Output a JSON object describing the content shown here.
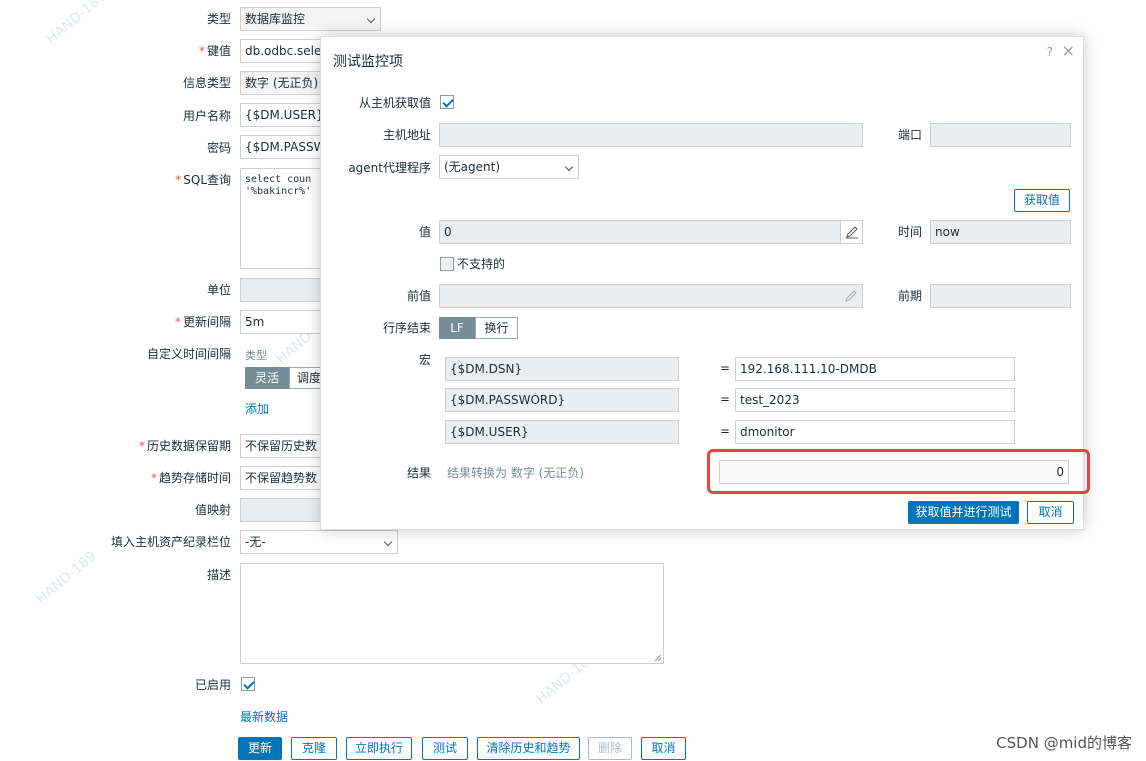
{
  "form": {
    "type_label": "类型",
    "type_value": "数据库监控",
    "key_label": "键值",
    "key_value": "db.odbc.select[",
    "info_type_label": "信息类型",
    "info_type_value": "数字 (无正负)",
    "user_label": "用户名称",
    "user_value": "{$DM.USER}",
    "password_label": "密码",
    "password_value": "{$DM.PASSWO",
    "sql_label": "SQL查询",
    "sql_line1": "select coun",
    "sql_line2": "'%bakincr%'",
    "unit_label": "单位",
    "interval_label": "更新间隔",
    "interval_value": "5m",
    "custom_interval_label": "自定义时间间隔",
    "custom_type_header": "类型",
    "flex_label": "灵活",
    "schedule_label": "调度",
    "add_link": "添加",
    "history_label": "历史数据保留期",
    "history_value": "不保留历史数",
    "trends_label": "趋势存储时间",
    "trends_value": "不保留趋势数",
    "valuemap_label": "值映射",
    "inventory_label": "填入主机资产纪录栏位",
    "inventory_value": "-无-",
    "desc_label": "描述",
    "enabled_label": "已启用",
    "latest_data_link": "最新数据"
  },
  "buttons": {
    "update": "更新",
    "clone": "克隆",
    "execute_now": "立即执行",
    "test": "测试",
    "clear_history": "清除历史和趋势",
    "delete": "删除",
    "cancel": "取消"
  },
  "dialog": {
    "title": "测试监控项",
    "help": "?",
    "close": "×",
    "get_from_host_label": "从主机获取值",
    "host_address_label": "主机地址",
    "port_label": "端口",
    "proxy_label": "agent代理程序",
    "proxy_value": "(无agent)",
    "get_value_button": "获取值",
    "value_label": "值",
    "value_value": "0",
    "time_label": "时间",
    "time_value": "now",
    "unsupported_label": "不支持的",
    "prev_value_label": "前值",
    "prev_time_label": "前期",
    "eol_label": "行序结束",
    "eol_lf": "LF",
    "eol_crlf": "换行",
    "macros_label": "宏",
    "macros": [
      {
        "name": "{$DM.DSN}",
        "value": "192.168.111.10-DMDB"
      },
      {
        "name": "{$DM.PASSWORD}",
        "value": "test_2023"
      },
      {
        "name": "{$DM.USER}",
        "value": "dmonitor"
      }
    ],
    "result_label": "结果",
    "result_note": "结果转换为 数字 (无正负)",
    "result_value": "0",
    "test_button": "获取值并进行测试",
    "cancel_button": "取消"
  },
  "watermark": "HAND-189",
  "footer": "CSDN @mid的博客",
  "colors": {
    "accent": "#0275b8",
    "highlight": "#e8433f"
  }
}
